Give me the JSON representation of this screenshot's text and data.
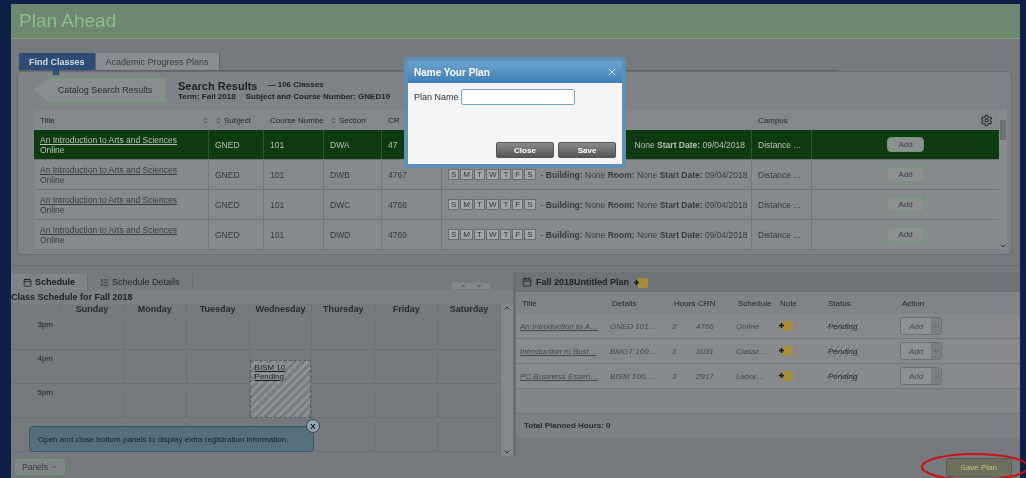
{
  "app_title": "Plan Ahead",
  "tabs": [
    {
      "label": "Find Classes",
      "selected": true
    },
    {
      "label": "Academic Progress Plans",
      "selected": false
    }
  ],
  "search": {
    "back_button": "Catalog Search Results",
    "heading": "Search Results",
    "count": "— 106 Classes",
    "term": "Term: Fall 2018",
    "subject": "Subject and Course Number: GNED10"
  },
  "results": {
    "columns": [
      {
        "label": "Title",
        "sortable": true
      },
      {
        "label": "Subject",
        "sortable": true
      },
      {
        "label": "Course Numbe",
        "sortable": false
      },
      {
        "label": "Section",
        "sortable": true
      },
      {
        "label": "CR",
        "sortable": false
      },
      {
        "label": "Campus",
        "sortable": false
      }
    ],
    "rows": [
      {
        "title": "An Introduction to Arts and Sciences",
        "mode": "Online",
        "subject": "GNED",
        "course": "101",
        "section": "DWA",
        "crn": "47",
        "meeting": "None **Start Date:** 09/04/2018",
        "campus": "Distance ...",
        "action": "Add",
        "selected": true
      },
      {
        "title": "An Introduction to Arts and Sciences",
        "mode": "Online",
        "subject": "GNED",
        "course": "101",
        "section": "DWB",
        "crn": "4767",
        "days": [
          "S",
          "M",
          "T",
          "W",
          "T",
          "F",
          "S"
        ],
        "meeting": "- **Building:** None **Room:** None **Start Date:** 09/04/2018",
        "campus": "Distance ...",
        "action": "Add",
        "selected": false
      },
      {
        "title": "An Introduction to Arts and Sciences",
        "mode": "Online",
        "subject": "GNED",
        "course": "101",
        "section": "DWC",
        "crn": "4768",
        "days": [
          "S",
          "M",
          "T",
          "W",
          "T",
          "F",
          "S"
        ],
        "meeting": "- **Building:** None **Room:** None **Start Date:** 09/04/2018",
        "campus": "Distance ...",
        "action": "Add",
        "selected": false
      },
      {
        "title": "An Introduction to Arts and Sciences",
        "mode": "Online",
        "subject": "GNED",
        "course": "101",
        "section": "DWD",
        "crn": "4769",
        "days": [
          "S",
          "M",
          "T",
          "W",
          "T",
          "F",
          "S"
        ],
        "meeting": "- **Building:** None **Room:** None **Start Date:** 09/04/2018",
        "campus": "Distance ...",
        "action": "Add",
        "selected": false
      }
    ]
  },
  "dialog": {
    "title": "Name Your Plan",
    "field_label": "Plan Name",
    "buttons": [
      "Close",
      "Save"
    ]
  },
  "bottom_tabs": [
    {
      "label": "Schedule",
      "selected": true
    },
    {
      "label": "Schedule Details",
      "selected": false
    }
  ],
  "schedule": {
    "title": "Class Schedule for Fall 2018",
    "times": [
      "3pm",
      "4pm",
      "5pm"
    ],
    "days": [
      {
        "name": "Sunday"
      },
      {
        "name": "Monday"
      },
      {
        "name": "Tuesday"
      },
      {
        "name": "Wednesday",
        "event": {
          "label": "BISM 10",
          "status": "Pending"
        }
      },
      {
        "name": "Thursday"
      },
      {
        "name": "Friday"
      },
      {
        "name": "Saturday"
      }
    ]
  },
  "tip": {
    "text": "Open and close bottom panels to display extra registration information.",
    "close": "X"
  },
  "plan": {
    "title": "Fall 2018Untitled Plan",
    "columns": [
      "Title",
      "Details",
      "Hours",
      "CRN",
      "Schedule",
      "Note",
      "Status",
      "Action"
    ],
    "rows": [
      {
        "title": "An Introduction to A…",
        "details": "GNED 101…",
        "hours": "3",
        "crn": "4766",
        "schedule": "Online",
        "status": "Pending",
        "action": "Add"
      },
      {
        "title": "Introduction to Busi…",
        "details": "BMGT 100…",
        "hours": "3",
        "crn": "3031",
        "schedule": "Classr…",
        "status": "Pending",
        "action": "Add"
      },
      {
        "title": "PC Business Essen…",
        "details": "BISM 100,…",
        "hours": "3",
        "crn": "2917",
        "schedule": "Labor…",
        "status": "Pending",
        "action": "Add"
      }
    ],
    "total": "Total Planned Hours: 0"
  },
  "footer": {
    "panels_button": "Panels",
    "save_button": "Save Plan"
  }
}
